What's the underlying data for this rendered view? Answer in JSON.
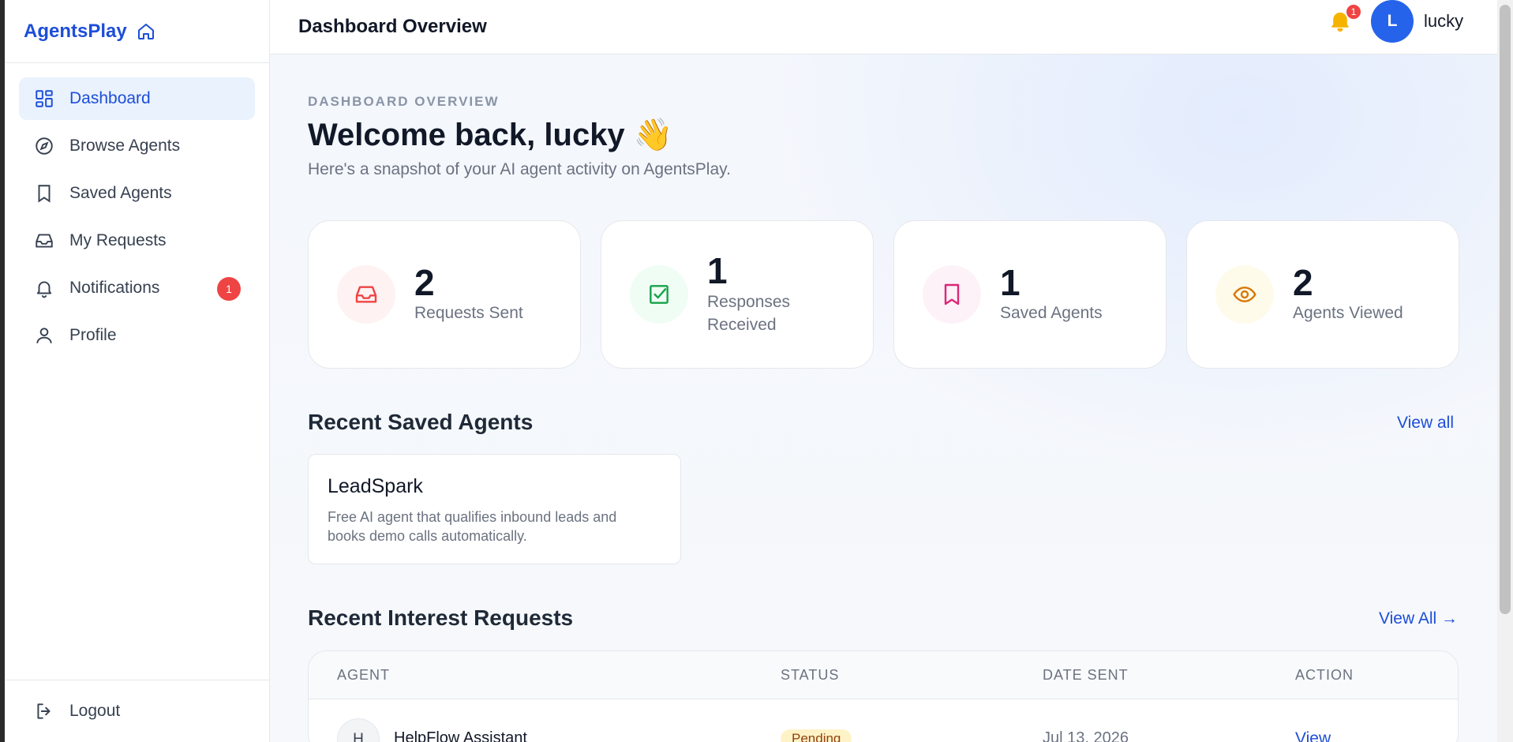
{
  "brand": {
    "name": "AgentsPlay",
    "icon": "home-icon"
  },
  "sidebar": {
    "items": [
      {
        "label": "Dashboard",
        "icon": "grid-icon",
        "active": true
      },
      {
        "label": "Browse Agents",
        "icon": "compass-icon"
      },
      {
        "label": "Saved Agents",
        "icon": "bookmark-icon"
      },
      {
        "label": "My Requests",
        "icon": "inbox-icon"
      },
      {
        "label": "Notifications",
        "icon": "bell-icon",
        "badge": "1"
      },
      {
        "label": "Profile",
        "icon": "user-icon"
      }
    ],
    "logout": {
      "label": "Logout",
      "icon": "logout-icon"
    }
  },
  "header": {
    "title": "Dashboard Overview",
    "notification_count": "1",
    "avatar_initial": "L",
    "username": "lucky"
  },
  "main": {
    "eyebrow": "DASHBOARD OVERVIEW",
    "welcome": "Welcome back, lucky 👋",
    "subtitle": "Here's a snapshot of your AI agent activity on AgentsPlay.",
    "stats": [
      {
        "value": "2",
        "label": "Requests Sent",
        "icon": "inbox-icon",
        "color": "#ef4444",
        "bg": "#fef2f2"
      },
      {
        "value": "1",
        "label": "Responses Received",
        "icon": "check-square-icon",
        "color": "#16a34a",
        "bg": "#f0fdf4"
      },
      {
        "value": "1",
        "label": "Saved Agents",
        "icon": "bookmark-icon",
        "color": "#db2777",
        "bg": "#fdf2f8"
      },
      {
        "value": "2",
        "label": "Agents Viewed",
        "icon": "eye-icon",
        "color": "#d97706",
        "bg": "#fffbeb"
      }
    ],
    "saved_section": {
      "title": "Recent Saved Agents",
      "link": "View all",
      "agents": [
        {
          "name": "LeadSpark",
          "description": "Free AI agent that qualifies inbound leads and books demo calls automatically."
        }
      ]
    },
    "requests_section": {
      "title": "Recent Interest Requests",
      "link": "View All →",
      "columns": [
        "AGENT",
        "STATUS",
        "DATE SENT",
        "ACTION"
      ],
      "rows": [
        {
          "initial": "H",
          "agent": "HelpFlow Assistant",
          "status": "Pending",
          "date": "Jul 13, 2026",
          "action": "View"
        }
      ]
    }
  }
}
